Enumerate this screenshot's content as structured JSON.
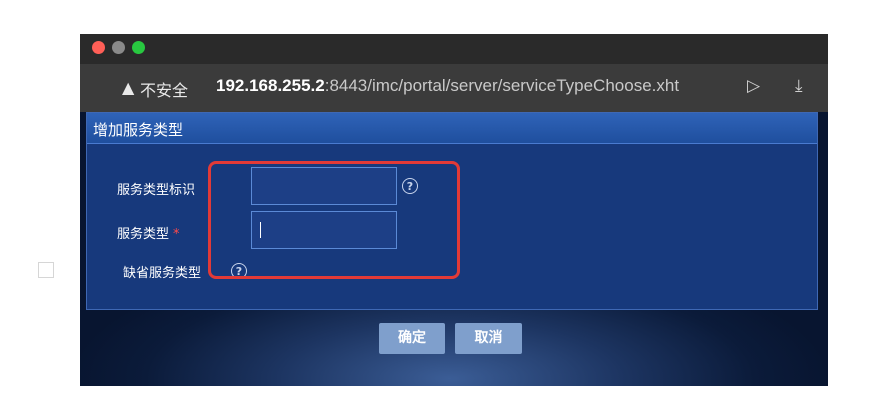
{
  "browser": {
    "insecure_label": "不安全",
    "url_host": "192.168.255.2",
    "url_path": ":8443/imc/portal/server/serviceTypeChoose.xht",
    "icons": [
      "warning-icon",
      "share-icon",
      "download-icon"
    ]
  },
  "dialog": {
    "title": "增加服务类型",
    "fields": {
      "service_type_id_label": "服务类型标识",
      "service_type_id_value": "",
      "service_type_label": "服务类型",
      "required_mark": "*",
      "service_type_value": "",
      "default_checkbox_label": "缺省服务类型"
    }
  },
  "buttons": {
    "ok": "确定",
    "cancel": "取消"
  },
  "colors": {
    "highlight": "#e23a37",
    "dialog_header": "#2f63b8",
    "button": "#7f9fcc"
  }
}
